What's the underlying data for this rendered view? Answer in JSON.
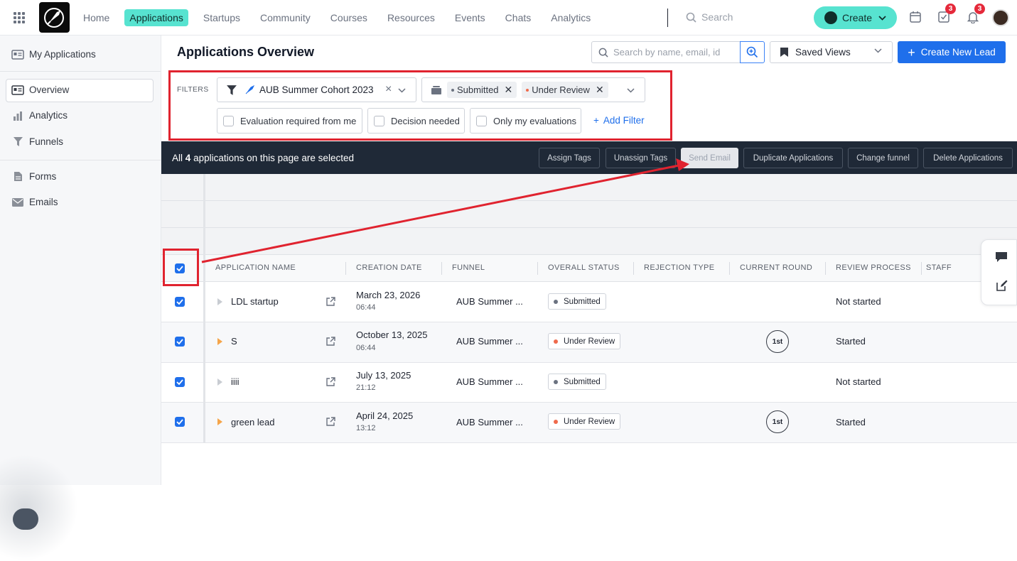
{
  "nav": {
    "items": [
      "Home",
      "Applications",
      "Startups",
      "Community",
      "Courses",
      "Resources",
      "Events",
      "Chats",
      "Analytics"
    ],
    "active": "Applications",
    "search_placeholder": "Search",
    "create_label": "Create",
    "tasks_badge": "3",
    "notif_badge": "3"
  },
  "sidebar": {
    "items": [
      "My Applications",
      "Overview",
      "Analytics",
      "Funnels",
      "Forms",
      "Emails"
    ],
    "active": "Overview"
  },
  "header": {
    "title": "Applications Overview",
    "search_placeholder": "Search by name, email, id",
    "saved_views": "Saved Views",
    "create_lead": "Create New Lead"
  },
  "filters": {
    "label": "FILTERS",
    "cohort": "AUB Summer Cohort 2023",
    "status_chips": [
      "Submitted",
      "Under Review"
    ],
    "checkboxes": [
      "Evaluation required from me",
      "Decision needed",
      "Only my evaluations"
    ],
    "add_filter": "Add Filter"
  },
  "bulk": {
    "text_prefix": "All",
    "count": "4",
    "text_suffix": "applications on this page are selected",
    "buttons": [
      "Assign Tags",
      "Unassign Tags",
      "Send Email",
      "Duplicate Applications",
      "Change funnel",
      "Delete Applications"
    ]
  },
  "table": {
    "columns": [
      "APPLICATION NAME",
      "CREATION DATE",
      "FUNNEL",
      "OVERALL STATUS",
      "REJECTION TYPE",
      "CURRENT ROUND",
      "REVIEW PROCESS",
      "STAFF"
    ],
    "rows": [
      {
        "name": "LDL startup",
        "date": "March 23, 2026",
        "time": "06:44",
        "funnel": "AUB Summer ...",
        "status": "Submitted",
        "round": "",
        "review": "Not started"
      },
      {
        "name": "S",
        "date": "October 13, 2025",
        "time": "06:44",
        "funnel": "AUB Summer ...",
        "status": "Under Review",
        "round": "1st",
        "review": "Started"
      },
      {
        "name": "iiii",
        "date": "July 13, 2025",
        "time": "21:12",
        "funnel": "AUB Summer ...",
        "status": "Submitted",
        "round": "",
        "review": "Not started"
      },
      {
        "name": "green lead",
        "date": "April 24, 2025",
        "time": "13:12",
        "funnel": "AUB Summer ...",
        "status": "Under Review",
        "round": "1st",
        "review": "Started"
      }
    ]
  },
  "colors": {
    "accent": "#57e3d0",
    "primary": "#1f6feb",
    "highlight": "#e0232f",
    "submitted_dot": "#6b7280",
    "review_dot": "#ef6a4c"
  }
}
